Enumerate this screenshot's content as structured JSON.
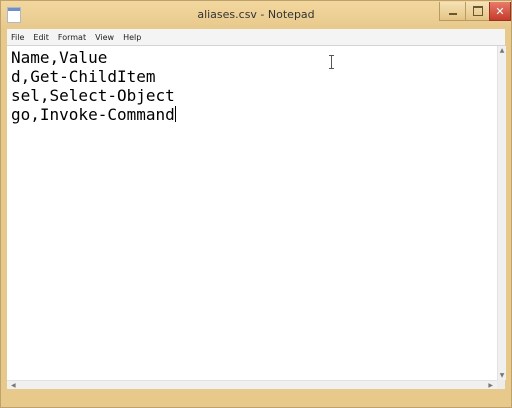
{
  "window": {
    "title": "aliases.csv - Notepad",
    "frame_color": "#e8c98c",
    "close_color": "#c43b2b"
  },
  "titlebar_buttons": {
    "minimize_icon": "minimize-icon",
    "maximize_icon": "maximize-icon",
    "close_icon": "close-icon",
    "close_glyph": "✕"
  },
  "menu": {
    "items": [
      {
        "label": "File"
      },
      {
        "label": "Edit"
      },
      {
        "label": "Format"
      },
      {
        "label": "View"
      },
      {
        "label": "Help"
      }
    ]
  },
  "editor": {
    "lines": [
      "Name,Value",
      "d,Get-ChildItem",
      "sel,Select-Object",
      "go,Invoke-Command"
    ]
  },
  "scrollbars": {
    "up_arrow": "▲",
    "down_arrow": "▼",
    "left_arrow": "◀",
    "right_arrow": "▶"
  }
}
